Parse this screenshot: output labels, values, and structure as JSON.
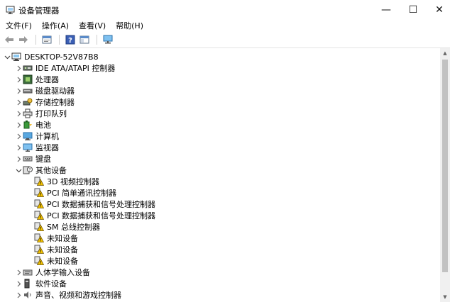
{
  "window": {
    "title": "设备管理器",
    "controls": {
      "minimize": "—",
      "maximize": "☐",
      "close": "✕"
    }
  },
  "menu": [
    "文件(F)",
    "操作(A)",
    "查看(V)",
    "帮助(H)"
  ],
  "toolbar": {
    "buttons": [
      "back-icon",
      "forward-icon",
      "properties-icon",
      "help-icon",
      "view-icon",
      "monitor-icon"
    ]
  },
  "tree": {
    "root": "DESKTOP-52V87B8",
    "categories": [
      {
        "label": "IDE ATA/ATAPI 控制器",
        "icon": "ide-controller-icon"
      },
      {
        "label": "处理器",
        "icon": "processor-icon"
      },
      {
        "label": "磁盘驱动器",
        "icon": "disk-drive-icon"
      },
      {
        "label": "存储控制器",
        "icon": "storage-controller-icon"
      },
      {
        "label": "打印队列",
        "icon": "printer-icon"
      },
      {
        "label": "电池",
        "icon": "battery-icon"
      },
      {
        "label": "计算机",
        "icon": "computer-icon"
      },
      {
        "label": "监视器",
        "icon": "monitor-icon"
      },
      {
        "label": "键盘",
        "icon": "keyboard-icon"
      },
      {
        "label": "其他设备",
        "icon": "other-devices-icon",
        "expanded": true
      }
    ],
    "other_devices": [
      "3D 视频控制器",
      "PCI 简单通讯控制器",
      "PCI 数据捕获和信号处理控制器",
      "PCI 数据捕获和信号处理控制器",
      "SM 总线控制器",
      "未知设备",
      "未知设备",
      "未知设备"
    ],
    "after": [
      {
        "label": "人体学输入设备",
        "icon": "hid-icon"
      },
      {
        "label": "软件设备",
        "icon": "software-device-icon"
      },
      {
        "label": "声音、视频和游戏控制器",
        "icon": "sound-icon"
      }
    ]
  },
  "colors": {
    "warning": "#f5c400",
    "selection": "#cce8ff",
    "accent": "#0078d7"
  }
}
